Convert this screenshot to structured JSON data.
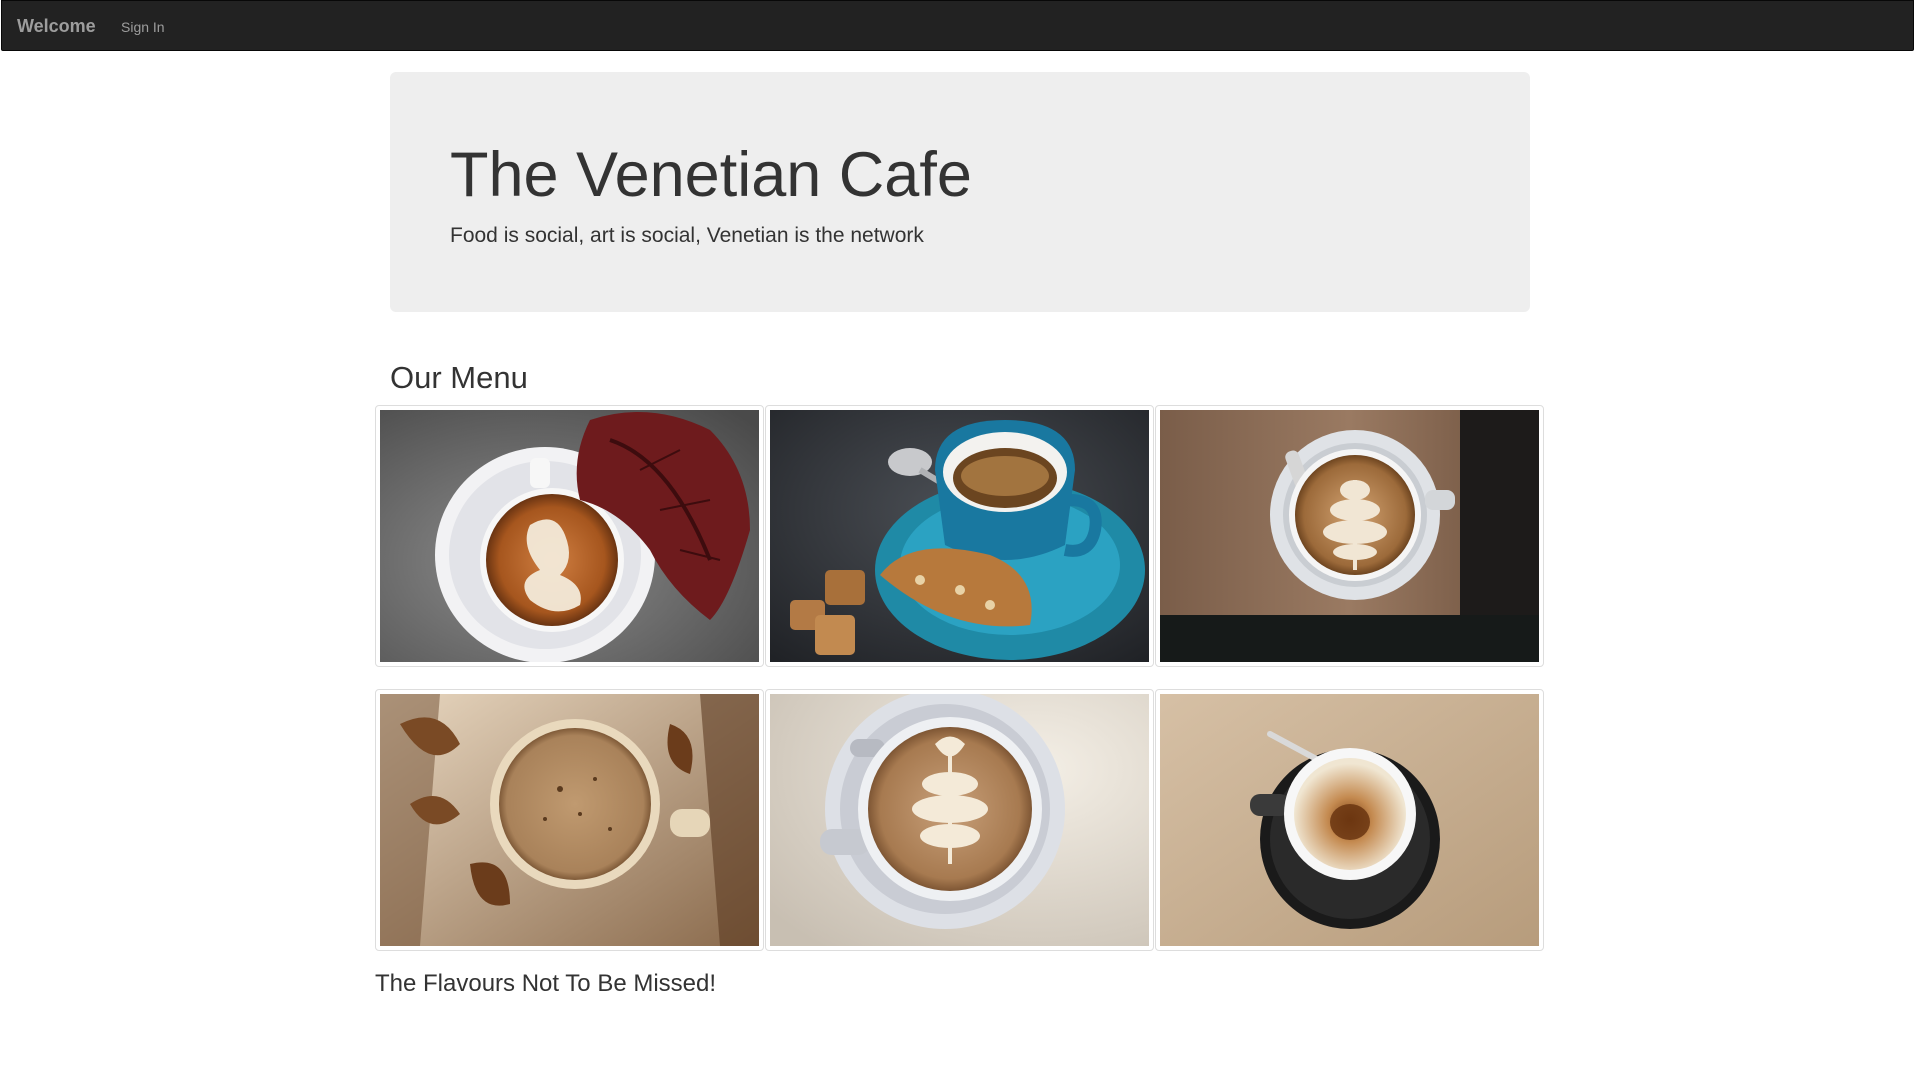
{
  "navbar": {
    "brand": "Welcome",
    "links": [
      {
        "label": "Sign In"
      }
    ]
  },
  "jumbotron": {
    "title": "The Venetian Cafe",
    "tagline": "Food is social, art is social, Venetian is the network"
  },
  "menu": {
    "heading": "Our Menu",
    "items": [
      {
        "icon": "latte-art-swan-with-autumn-leaf"
      },
      {
        "icon": "espresso-blue-cup-with-biscotti"
      },
      {
        "icon": "latte-art-tulip-on-wood-table"
      },
      {
        "icon": "milky-coffee-mug-with-dried-leaves"
      },
      {
        "icon": "latte-art-heart-white-cup"
      },
      {
        "icon": "espresso-black-saucer-with-spoon"
      }
    ]
  },
  "footer": {
    "tagline": "The Flavours Not To Be Missed!"
  },
  "colors": {
    "navbar_bg": "#222222",
    "navbar_text": "#9d9d9d",
    "jumbotron_bg": "#eeeeee",
    "text": "#333333"
  }
}
